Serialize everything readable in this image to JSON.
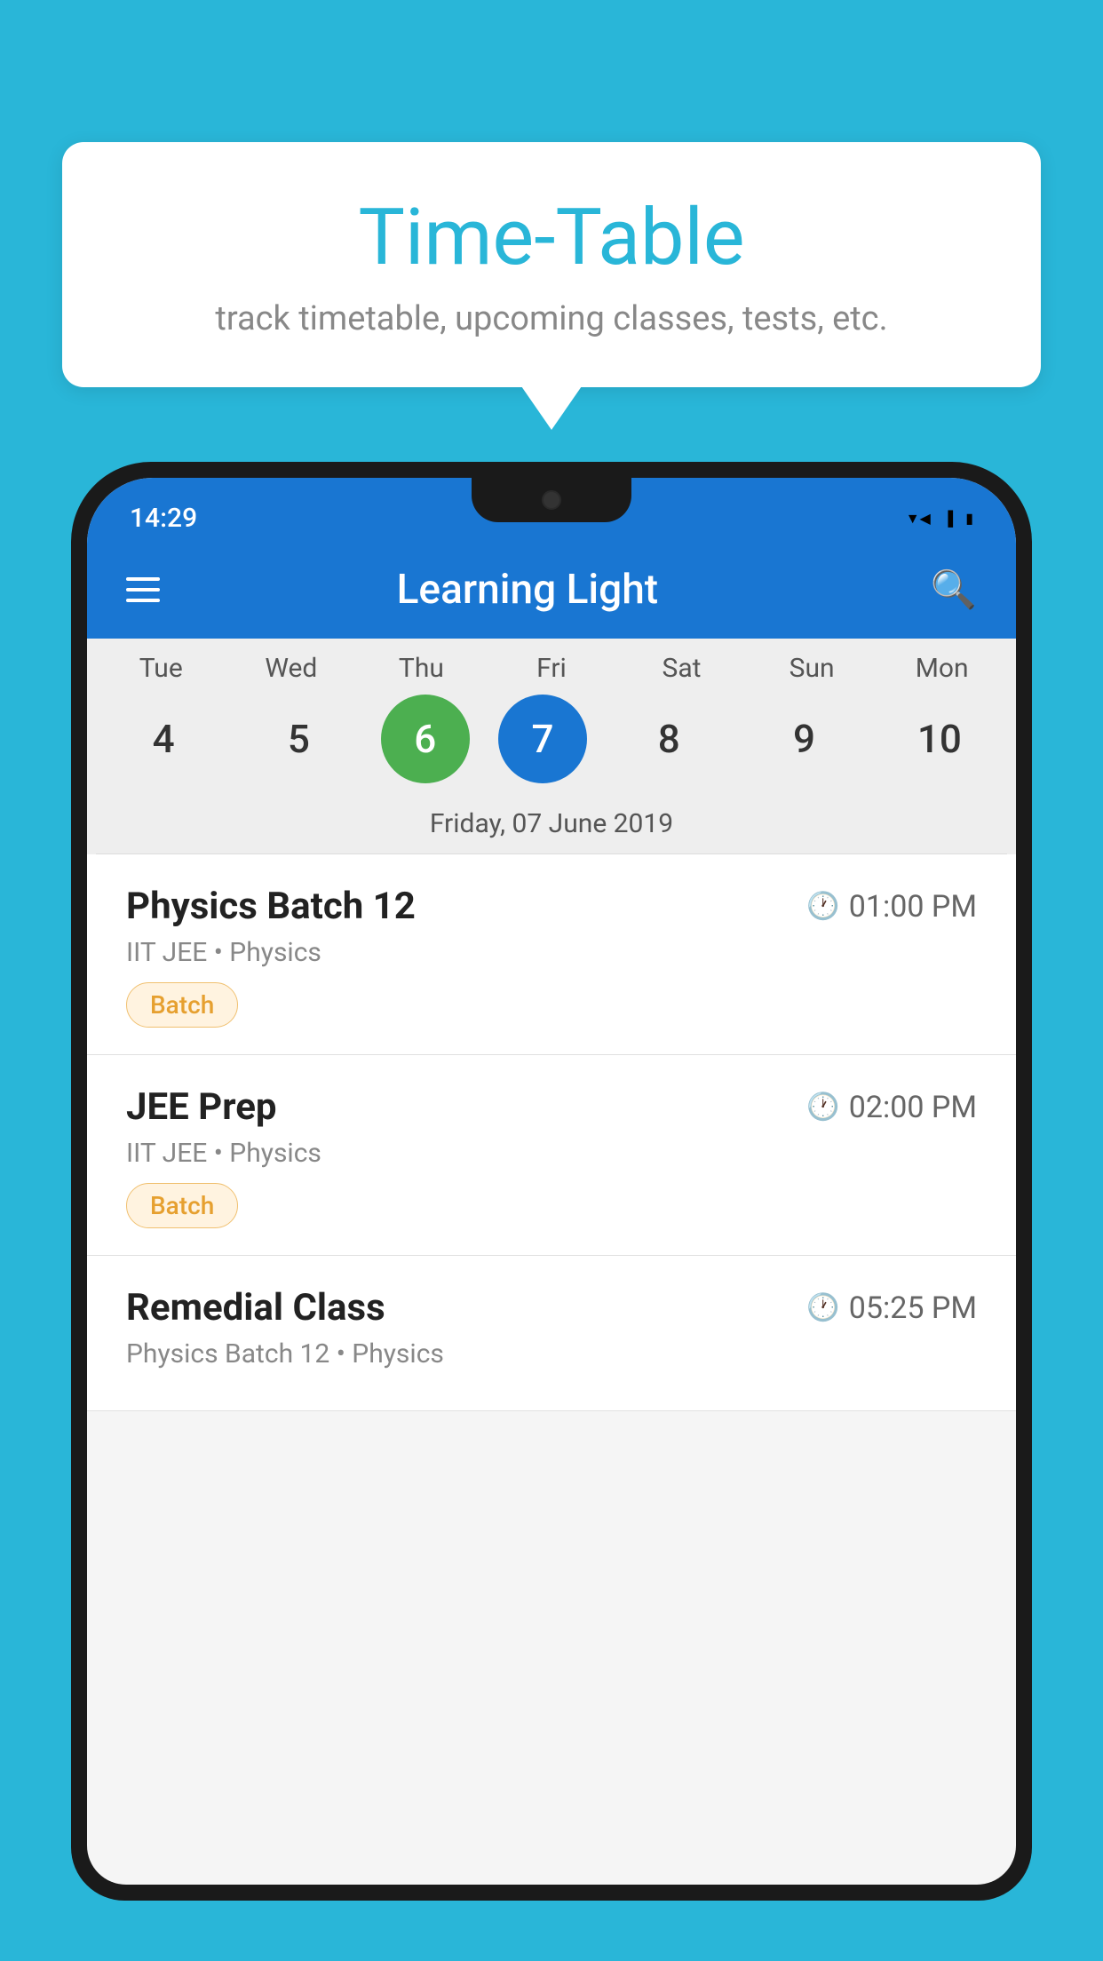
{
  "background_color": "#29B6D8",
  "speech_bubble": {
    "title": "Time-Table",
    "subtitle": "track timetable, upcoming classes, tests, etc."
  },
  "status_bar": {
    "time": "14:29",
    "icons": [
      "wifi",
      "signal",
      "battery"
    ]
  },
  "app_header": {
    "title": "Learning Light",
    "menu_icon": "hamburger-icon",
    "search_icon": "search-icon"
  },
  "calendar": {
    "days": [
      "Tue",
      "Wed",
      "Thu",
      "Fri",
      "Sat",
      "Sun",
      "Mon"
    ],
    "dates": [
      "4",
      "5",
      "6",
      "7",
      "8",
      "9",
      "10"
    ],
    "today_index": 2,
    "selected_index": 3,
    "selected_date_label": "Friday, 07 June 2019"
  },
  "schedule": [
    {
      "title": "Physics Batch 12",
      "time": "01:00 PM",
      "subtitle": "IIT JEE • Physics",
      "tag": "Batch"
    },
    {
      "title": "JEE Prep",
      "time": "02:00 PM",
      "subtitle": "IIT JEE • Physics",
      "tag": "Batch"
    },
    {
      "title": "Remedial Class",
      "time": "05:25 PM",
      "subtitle": "Physics Batch 12 • Physics",
      "tag": null
    }
  ]
}
